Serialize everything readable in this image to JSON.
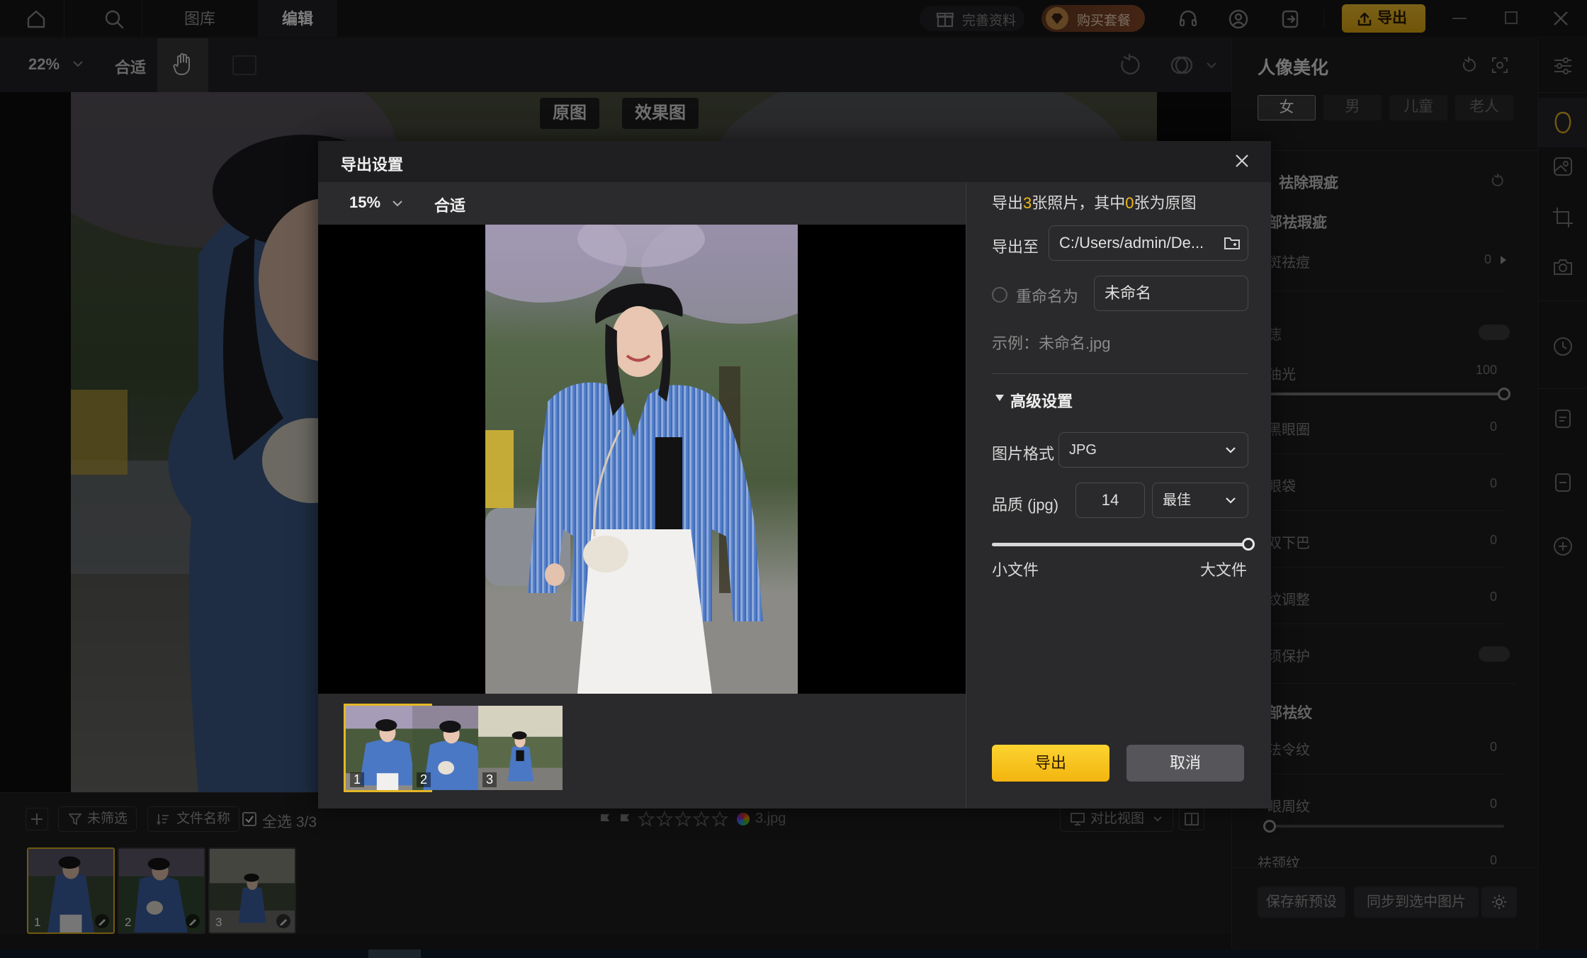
{
  "titlebar": {
    "tabs": [
      "图库",
      "编辑"
    ],
    "active_tab": "编辑",
    "complete_profile": "完善资料",
    "buy_package": "购买套餐",
    "export_label": "导出"
  },
  "toolbar": {
    "zoom": "22%",
    "fit_label": "合适"
  },
  "canvas": {
    "original_label": "原图",
    "effect_label": "效果图"
  },
  "bottombar": {
    "filter_label": "未筛选",
    "sort_label": "文件名称",
    "select_all_label": "全选 3/3",
    "filename": "3.jpg",
    "compare_view_label": "对比视图",
    "thumbnails": [
      "1",
      "2",
      "3"
    ]
  },
  "right_panel": {
    "title": "人像美化",
    "gender_tabs": [
      "女",
      "男",
      "儿童",
      "老人"
    ],
    "active_gender": "女",
    "section_blemish": "祛除瑕疵",
    "sub_face_blemish": "部祛瑕疵",
    "rows": [
      {
        "label": "斑祛痘",
        "value": "0"
      },
      {
        "label": "痣",
        "value": ""
      },
      {
        "label": "油光",
        "value": "100"
      },
      {
        "label": "黑眼圈",
        "value": "0"
      },
      {
        "label": "眼袋",
        "value": "0"
      },
      {
        "label": "双下巴",
        "value": "0"
      },
      {
        "label": "纹调整",
        "value": "0"
      },
      {
        "label": "须保护",
        "value": ""
      }
    ],
    "sub_wrinkle": "部祛纹",
    "rows2": [
      {
        "label": "法令纹",
        "value": "0"
      },
      {
        "label": "眼周纹",
        "value": "0"
      },
      {
        "label": "祛颈纹",
        "value": "0"
      }
    ],
    "shine_slider_level": 1.0,
    "save_preset": "保存新预设",
    "sync_selected": "同步到选中图片"
  },
  "dialog": {
    "title": "导出设置",
    "preview_zoom": "15%",
    "preview_fit": "合适",
    "summary_prefix": "导出",
    "summary_count": "3",
    "summary_mid": "张照片，其中",
    "summary_original": "0",
    "summary_suffix": "张为原图",
    "export_to_label": "导出至",
    "export_path": "C:/Users/admin/De...",
    "rename_label": "重命名为",
    "rename_value": "未命名",
    "example_text": "示例：未命名.jpg",
    "advanced_label": "高级设置",
    "format_label": "图片格式",
    "format_value": "JPG",
    "quality_label": "品质 (jpg)",
    "quality_value": "14",
    "quality_preset": "最佳",
    "quality_slider_level": 1.0,
    "small_file": "小文件",
    "large_file": "大文件",
    "export_button": "导出",
    "cancel_button": "取消",
    "thumbnails": [
      "1",
      "2",
      "3"
    ]
  },
  "colors": {
    "accent": "#f2b91c",
    "export_button_gradient": [
      "#fcd331",
      "#f3b50f"
    ]
  }
}
